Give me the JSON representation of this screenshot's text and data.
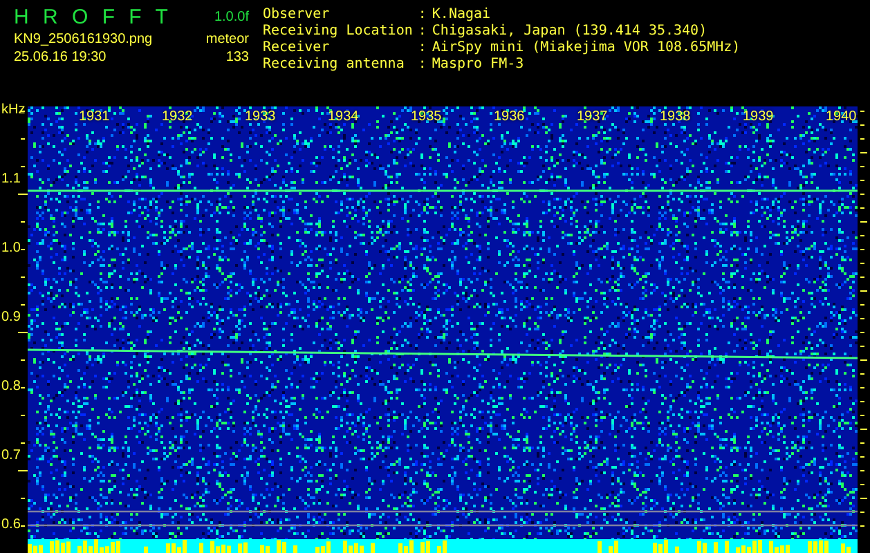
{
  "header": {
    "title": "H R O F F T",
    "version": "1.0.0f",
    "file": "KN9_2506161930.png",
    "date_time": "25.06.16 19:30",
    "count_label": "meteor",
    "count": "133",
    "info": [
      {
        "label": "Observer",
        "separator": ":",
        "value": "K.Nagai"
      },
      {
        "label": "Receiving Location",
        "separator": ":",
        "value": "Chigasaki, Japan (139.414 35.340)"
      },
      {
        "label": "Receiver",
        "separator": ":",
        "value": "AirSpy mini (Miakejima VOR 108.65MHz)"
      },
      {
        "label": "Receiving antenna",
        "separator": ":",
        "value": "Maspro FM-3"
      }
    ]
  },
  "spectrogram": {
    "unit": "kHz",
    "y_labels": [
      "1.1",
      "1.0",
      "0.9",
      "0.8",
      "0.7",
      "0.6"
    ],
    "time_labels": [
      "1931",
      "1932",
      "1933",
      "1934",
      "1935",
      "1936",
      "1937",
      "1938",
      "1939",
      "1940"
    ]
  }
}
